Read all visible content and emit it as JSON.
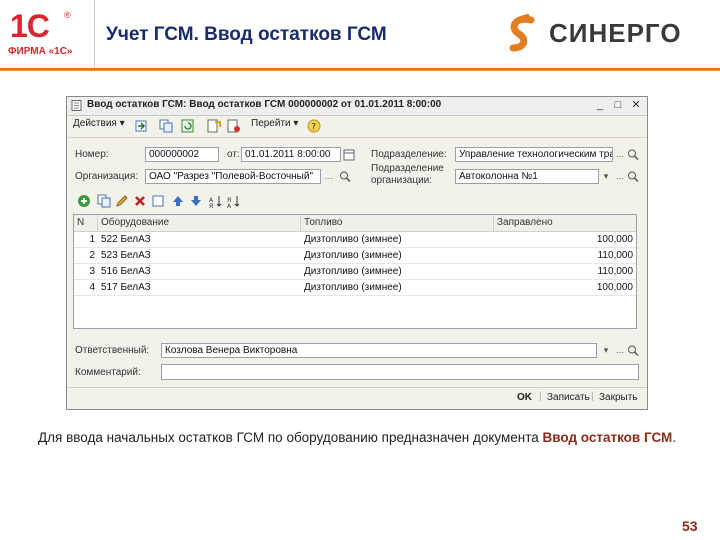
{
  "header": {
    "logo_1c": "1С",
    "logo_firm": "ФИРМА «1С»",
    "title": "Учет ГСМ. Ввод остатков ГСМ",
    "logo_sinergo": "СИНЕРГО"
  },
  "window": {
    "title": "Ввод остатков ГСМ: Ввод остатков ГСМ 000000002 от 01.01.2011 8:00:00",
    "toolbar": {
      "actions": "Действия",
      "goto": "Перейти"
    },
    "fields": {
      "number_label": "Номер:",
      "number_value": "000000002",
      "from_label": "от:",
      "from_value": "01.01.2011  8:00:00",
      "division_label": "Подразделение:",
      "division_value": "Управление технологическим тра",
      "org_label": "Организация:",
      "org_value": "ОАО \"Разрез \"Полевой-Восточный\"",
      "orgdiv_label1": "Подразделение",
      "orgdiv_label2": "организации:",
      "orgdiv_value": "Автоколонна №1"
    },
    "table": {
      "headers": [
        "N",
        "Оборудование",
        "Топливо",
        "Заправлено"
      ],
      "rows": [
        {
          "n": "1",
          "equipment": "522 БелАЗ",
          "fuel": "Дизтопливо (зимнее)",
          "amount": "100,000"
        },
        {
          "n": "2",
          "equipment": "523 БелАЗ",
          "fuel": "Дизтопливо (зимнее)",
          "amount": "110,000"
        },
        {
          "n": "3",
          "equipment": "516 БелАЗ",
          "fuel": "Дизтопливо (зимнее)",
          "amount": "110,000"
        },
        {
          "n": "4",
          "equipment": "517 БелАЗ",
          "fuel": "Дизтопливо (зимнее)",
          "amount": "100,000"
        }
      ]
    },
    "responsible_label": "Ответственный:",
    "responsible_value": "Козлова Венера Викторовна",
    "comment_label": "Комментарий:",
    "comment_value": "",
    "buttons": {
      "ok": "OK",
      "save": "Записать",
      "close": "Закрыть"
    }
  },
  "caption": {
    "text": "Для ввода начальных остатков ГСМ по оборудованию предназначен документа ",
    "highlight": "Ввод остатков ГСМ",
    "end": "."
  },
  "page_number": "53",
  "colors": {
    "accent": "#8b2b1a",
    "brand_red": "#d8262e",
    "orange": "#e07f22",
    "title_blue": "#1a2b6e"
  }
}
